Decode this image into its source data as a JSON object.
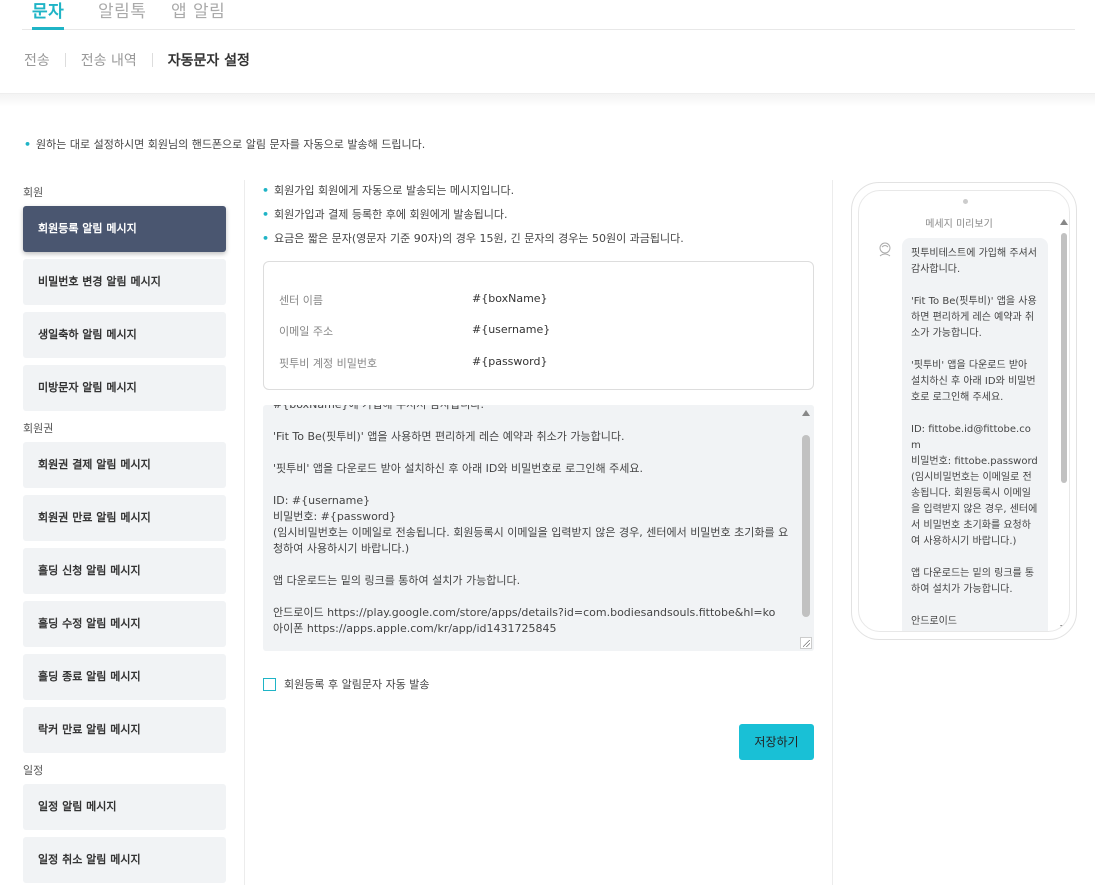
{
  "top_tabs": [
    "문자",
    "알림톡",
    "앱 알림"
  ],
  "sub_tabs": [
    "전송",
    "전송 내역",
    "자동문자 설정"
  ],
  "notice": "원하는 대로 설정하시면 회원님의 핸드폰으로 알림 문자를 자동으로 발송해 드립니다.",
  "sidebar": {
    "groups": [
      {
        "label": "회원",
        "items": [
          "회원등록 알림 메시지",
          "비밀번호 변경 알림 메시지",
          "생일축하 알림 메시지",
          "미방문자 알림 메시지"
        ]
      },
      {
        "label": "회원권",
        "items": [
          "회원권 결제 알림 메시지",
          "회원권 만료 알림 메시지",
          "홀딩 신청 알림 메시지",
          "홀딩 수정 알림 메시지",
          "홀딩 종료 알림 메시지",
          "락커 만료 알림 메시지"
        ]
      },
      {
        "label": "일정",
        "items": [
          "일정 알림 메시지",
          "일정 취소 알림 메시지"
        ]
      }
    ]
  },
  "info_lines": [
    "회원가입 회원에게 자동으로 발송되는 메시지입니다.",
    "회원가입과 결제 등록한 후에 회원에게 발송됩니다.",
    "요금은 짧은 문자(영문자 기준 90자)의 경우 15원, 긴 문자의 경우는 50원이 과금됩니다."
  ],
  "variables": [
    {
      "key": "센터 이름",
      "value": "#{boxName}"
    },
    {
      "key": "이메일 주소",
      "value": "#{username}"
    },
    {
      "key": "핏투비 계정 비밀번호",
      "value": "#{password}"
    }
  ],
  "message_text": "#{boxName}에 가입해 주셔서 감사합니다.\n\n'Fit To Be(핏투비)' 앱을 사용하면 편리하게 레슨 예약과 취소가 가능합니다.\n\n'핏투비' 앱을 다운로드 받아 설치하신 후 아래 ID와 비밀번호로 로그인해 주세요.\n\nID: #{username}\n비밀번호: #{password}\n(임시비밀번호는 이메일로 전송됩니다. 회원등록시 이메일을 입력받지 않은 경우, 센터에서 비밀번호 초기화를 요청하여 사용하시기 바랍니다.)\n\n앱 다운로드는 밑의 링크를 통하여 설치가 가능합니다.\n\n안드로이드 https://play.google.com/store/apps/details?id=com.bodiesandsouls.fittobe&hl=ko\n아이폰 https://apps.apple.com/kr/app/id1431725845",
  "auto_send_label": "회원등록 후 알림문자 자동 발송",
  "save_label": "저장하기",
  "preview": {
    "title": "메세지 미리보기",
    "text": "핏투비테스트에 가입해 주셔서 감사합니다.\n\n'Fit To Be(핏투비)' 앱을 사용하면 편리하게 레슨 예약과 취소가 가능합니다.\n\n'핏투비' 앱을 다운로드 받아 설치하신 후 아래 ID와 비밀번호로 로그인해 주세요.\n\nID: fittobe.id@fittobe.com\n비밀번호: fittobe.password\n(임시비밀번호는 이메일로 전송됩니다. 회원등록시 이메일을 입력받지 않은 경우, 센터에서 비밀번호 초기화를 요청하여 사용하시기 바랍니다.)\n\n앱 다운로드는 밑의 링크를 통하여 설치가 가능합니다.\n\n안드로이드\nhttps://play.google.com/store/apps/details?id=com.bodiesandsouls.fittobe&hl=ko"
  },
  "colors": {
    "accent": "#1fb4c6",
    "active_menu": "#4a5670",
    "save_button": "#19c0d6"
  }
}
